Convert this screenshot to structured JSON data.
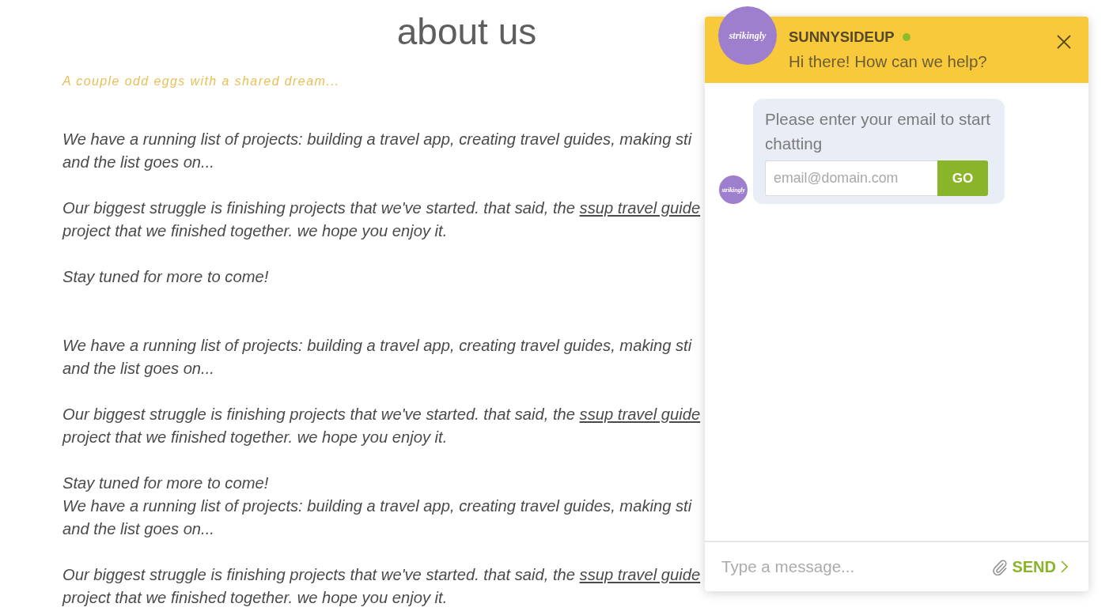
{
  "page": {
    "title": "about us",
    "tagline": "A couple odd eggs with a shared dream...",
    "sections": [
      {
        "paragraphs": [
          {
            "lines": [
              {
                "text": "We have a running list of projects: building a travel app, creating travel guides, making sti"
              },
              {
                "text": "and the list goes on..."
              }
            ]
          },
          {
            "lines": [
              {
                "text": "Our biggest struggle is finishing projects that we've started. that said, the",
                "link": "ssup travel guide"
              },
              {
                "text": "project that we finished together. we hope you enjoy it."
              }
            ]
          },
          {
            "lines": [
              {
                "text": "Stay tuned for more to come!"
              }
            ]
          }
        ]
      },
      {
        "paragraphs": [
          {
            "lines": [
              {
                "text": "We have a running list of projects: building a travel app, creating travel guides, making sti"
              },
              {
                "text": "and the list goes on..."
              }
            ]
          },
          {
            "lines": [
              {
                "text": "Our biggest struggle is finishing projects that we've started. that said, the",
                "link": "ssup travel guide"
              },
              {
                "text": "project that we finished together. we hope you enjoy it."
              }
            ]
          },
          {
            "lines": [
              {
                "text": "Stay tuned for more to come!"
              },
              {
                "text": "We have a running list of projects: building a travel app, creating travel guides, making sti"
              },
              {
                "text": "and the list goes on..."
              }
            ]
          },
          {
            "lines": [
              {
                "text": "Our biggest struggle is finishing projects that we've started. that said, the",
                "link": "ssup travel guide"
              },
              {
                "text": "project that we finished together. we hope you enjoy it."
              }
            ]
          }
        ]
      }
    ]
  },
  "chat": {
    "avatar_text": "strikingly",
    "name": "SUNNYSIDEUP",
    "online": true,
    "greeting": "Hi there! How can we help?",
    "messages": [
      {
        "kind": "email_prompt",
        "avatar_text": "strikingly",
        "text": "Please enter your email to start chatting",
        "input": {
          "placeholder": "email@domain.com"
        },
        "button": "GO"
      }
    ],
    "composer": {
      "placeholder": "Type a message...",
      "send": "SEND"
    }
  }
}
